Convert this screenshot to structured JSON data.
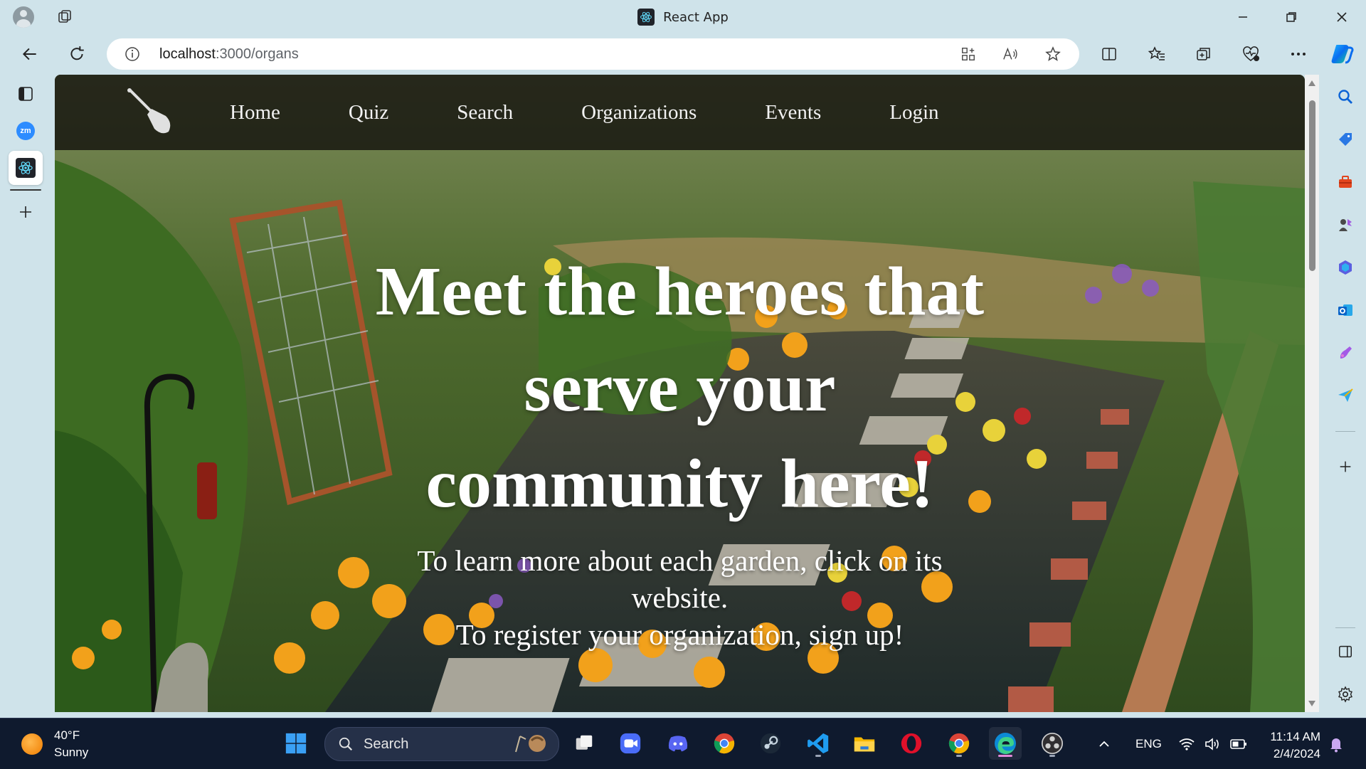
{
  "window": {
    "title": "React App"
  },
  "address_bar": {
    "url_host": "localhost",
    "url_path": ":3000/organs"
  },
  "site": {
    "nav_links": [
      "Home",
      "Quiz",
      "Search",
      "Organizations",
      "Events",
      "Login"
    ],
    "hero_title": "Meet the heroes that serve your community here!",
    "hero_line1": "To learn more about each garden, click on its website.",
    "hero_line2": "To register your organization, sign up!"
  },
  "vertical_tabs": {
    "zoom_label": "zm"
  },
  "taskbar": {
    "weather_temp": "40°F",
    "weather_desc": "Sunny",
    "search_label": "Search",
    "language": "ENG",
    "time": "11:14 AM",
    "date": "2/4/2024"
  },
  "colors": {
    "chrome_bg": "#cfe3ea",
    "site_nav_bg": "#14120e",
    "taskbar_bg": "#0f1a2e",
    "accent": "#0b63d6"
  }
}
